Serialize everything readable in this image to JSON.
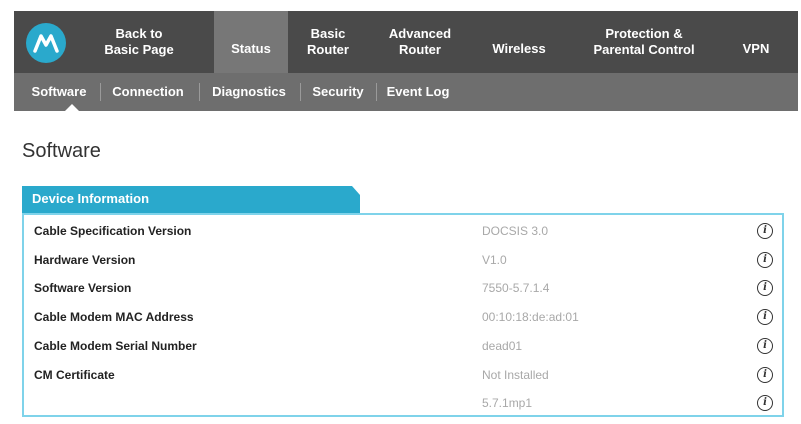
{
  "top_nav": {
    "logo_glyph": "M",
    "items": [
      {
        "line1": "Back to",
        "line2": "Basic Page"
      },
      {
        "line1": "Status",
        "line2": ""
      },
      {
        "line1": "Basic",
        "line2": "Router"
      },
      {
        "line1": "Advanced",
        "line2": "Router"
      },
      {
        "line1": "Wireless",
        "line2": ""
      },
      {
        "line1": "Protection &",
        "line2": "Parental Control"
      },
      {
        "line1": "VPN",
        "line2": ""
      }
    ]
  },
  "sub_nav": {
    "items": [
      "Software",
      "Connection",
      "Diagnostics",
      "Security",
      "Event Log"
    ]
  },
  "page": {
    "title": "Software",
    "section_title": "Device Information",
    "rows": [
      {
        "label": "Cable Specification Version",
        "value": "DOCSIS 3.0"
      },
      {
        "label": "Hardware Version",
        "value": "V1.0"
      },
      {
        "label": "Software Version",
        "value": "7550-5.7.1.4"
      },
      {
        "label": "Cable Modem MAC Address",
        "value": "00:10:18:de:ad:01"
      },
      {
        "label": "Cable Modem Serial Number",
        "value": "dead01"
      },
      {
        "label": "CM Certificate",
        "value": "Not Installed"
      },
      {
        "label": "",
        "value": "5.7.1mp1"
      }
    ],
    "info_icon_glyph": "i"
  },
  "colors": {
    "accent": "#2aa9cc",
    "nav_bg": "#4a4a4a",
    "nav_active": "#777777",
    "subnav_bg": "#6e6e6e"
  }
}
